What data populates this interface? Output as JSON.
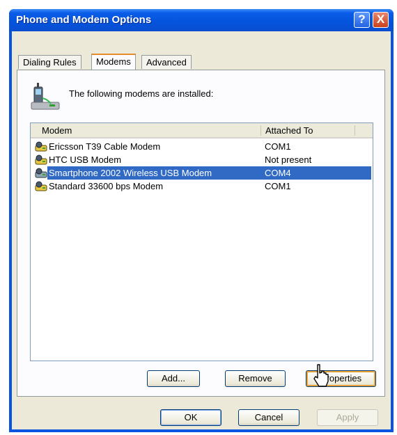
{
  "window": {
    "title": "Phone and Modem Options",
    "help_glyph": "?",
    "close_glyph": "X"
  },
  "tabs": [
    {
      "label": "Dialing Rules"
    },
    {
      "label": "Modems"
    },
    {
      "label": "Advanced"
    }
  ],
  "modems_tab": {
    "intro_text": "The following modems are  installed:",
    "columns": [
      "Modem",
      "Attached To"
    ],
    "rows": [
      {
        "name": "Ericsson T39 Cable Modem",
        "port": "COM1"
      },
      {
        "name": "HTC USB Modem",
        "port": "Not present"
      },
      {
        "name": "Smartphone 2002 Wireless USB Modem",
        "port": "COM4"
      },
      {
        "name": "Standard 33600 bps Modem",
        "port": "COM1"
      }
    ],
    "selected_row": "Smartphone 2002 Wireless USB Modem",
    "buttons": {
      "add": "Add...",
      "remove": "Remove",
      "properties": "Properties"
    }
  },
  "dialog_buttons": {
    "ok": "OK",
    "cancel": "Cancel",
    "apply": "Apply"
  },
  "icons": {
    "help": "help-icon",
    "close": "close-icon",
    "phone": "phone-modem-icon",
    "modem": "modem-icon",
    "cursor": "mouse-cursor-icon"
  },
  "colors": {
    "titlebar": "#0a5ce8",
    "selection": "#316ac5",
    "active_tab_accent": "#e68b2c"
  }
}
